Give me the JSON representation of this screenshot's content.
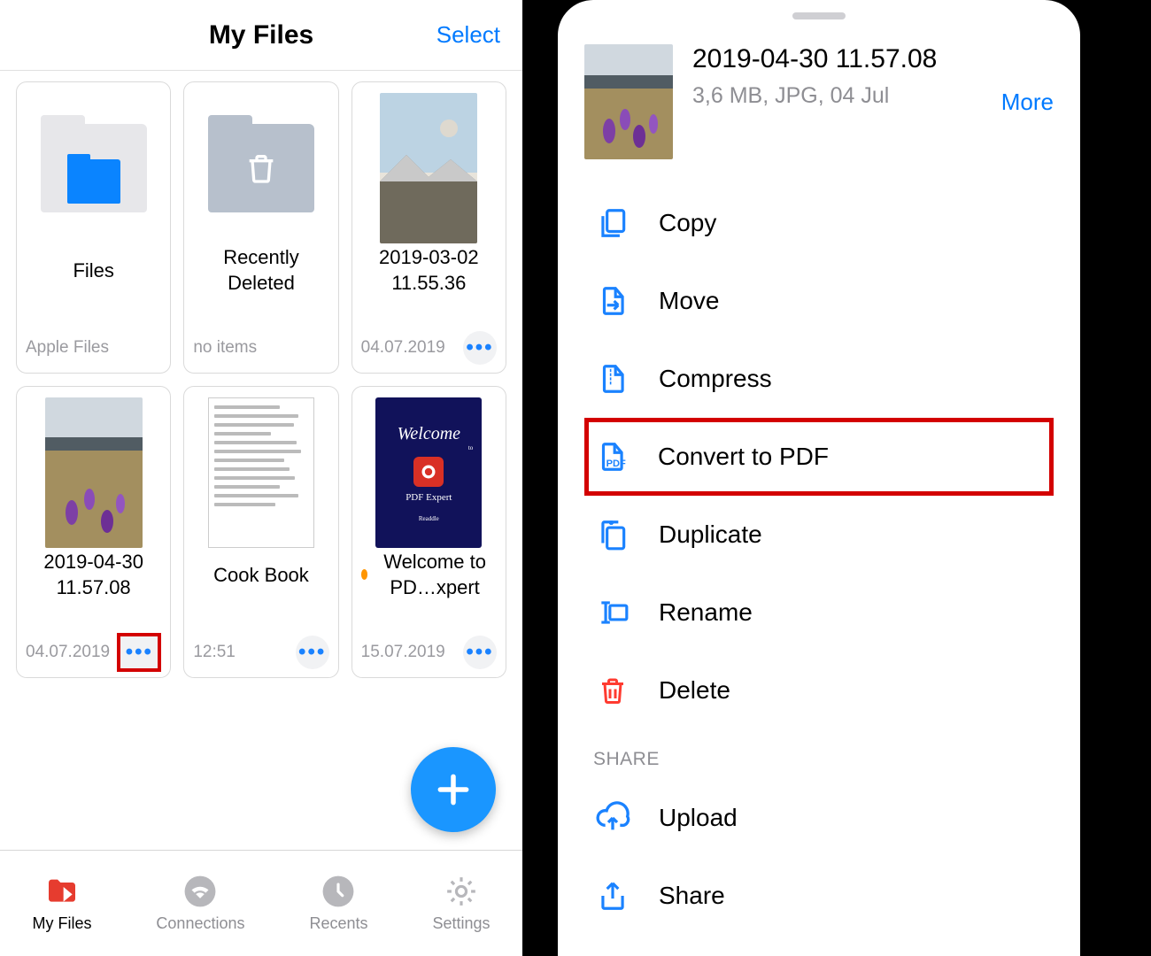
{
  "left": {
    "title": "My Files",
    "select": "Select",
    "cards": {
      "files": {
        "name": "Files",
        "sub": "Apple Files"
      },
      "deleted": {
        "name": "Recently Deleted",
        "sub": "no items"
      },
      "photo1": {
        "name": "2019-03-02 11.55.36",
        "sub": "04.07.2019"
      },
      "photo2": {
        "name": "2019-04-30 11.57.08",
        "sub": "04.07.2019"
      },
      "cook": {
        "name": "Cook Book",
        "sub": "12:51"
      },
      "welcome": {
        "name": "Welcome to PD…xpert",
        "sub": "15.07.2019"
      }
    },
    "tabs": {
      "myfiles": "My Files",
      "connections": "Connections",
      "recents": "Recents",
      "settings": "Settings"
    }
  },
  "right": {
    "file_title": "2019-04-30 11.57.08",
    "file_sub": "3,6 MB, JPG, 04 Jul",
    "more": "More",
    "actions": {
      "copy": "Copy",
      "move": "Move",
      "compress": "Compress",
      "convert": "Convert to PDF",
      "duplicate": "Duplicate",
      "rename": "Rename",
      "delete": "Delete"
    },
    "share_section": "SHARE",
    "share_actions": {
      "upload": "Upload",
      "share": "Share"
    }
  }
}
